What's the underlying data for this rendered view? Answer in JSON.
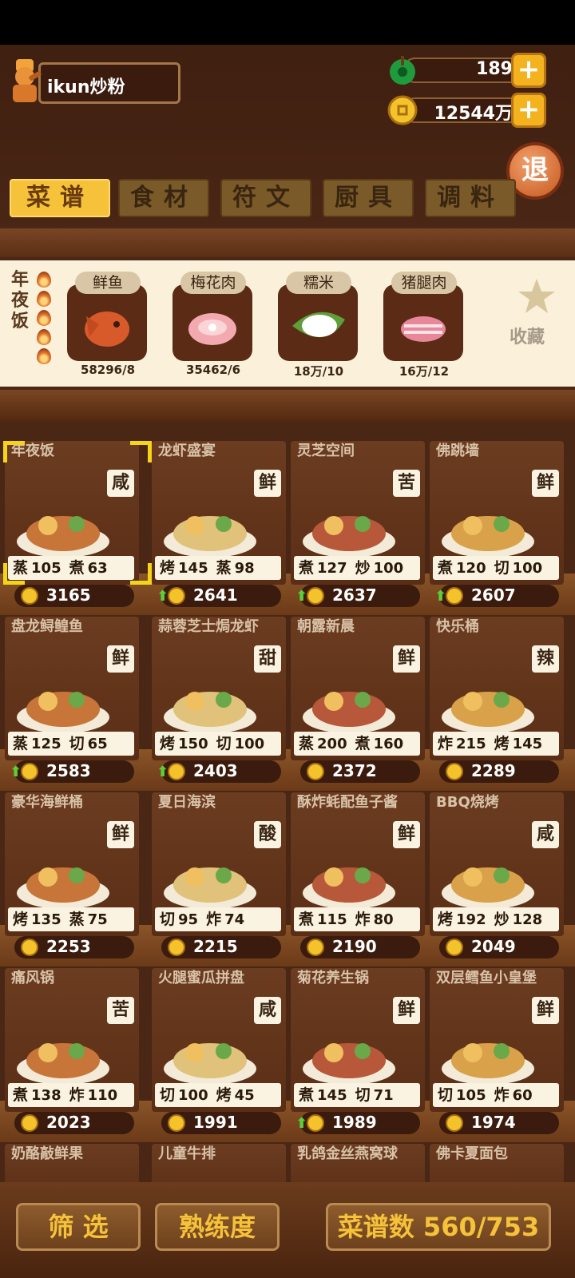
{
  "player": {
    "name": "ikun炒粉"
  },
  "currency": {
    "jade": "189",
    "coins": "12544万"
  },
  "exit_label": "退",
  "tabs": [
    {
      "label": "菜谱",
      "active": true
    },
    {
      "label": "食材",
      "active": false
    },
    {
      "label": "符文",
      "active": false
    },
    {
      "label": "厨具",
      "active": false
    },
    {
      "label": "调料",
      "active": false
    }
  ],
  "event": {
    "title": "年夜饭",
    "ingredients": [
      {
        "name": "鲜鱼",
        "count": "58296/8"
      },
      {
        "name": "梅花肉",
        "count": "35462/6"
      },
      {
        "name": "糯米",
        "count": "18万/10"
      },
      {
        "name": "猪腿肉",
        "count": "16万/12"
      }
    ],
    "favorite_label": "收藏"
  },
  "recipes": [
    {
      "name": "年夜饭",
      "flavor": "咸",
      "stat1": "蒸",
      "v1": "105",
      "stat2": "煮",
      "v2": "63",
      "price": "3165",
      "up": false
    },
    {
      "name": "龙虾盛宴",
      "flavor": "鲜",
      "stat1": "烤",
      "v1": "145",
      "stat2": "蒸",
      "v2": "98",
      "price": "2641",
      "up": true
    },
    {
      "name": "灵芝空间",
      "flavor": "苦",
      "stat1": "煮",
      "v1": "127",
      "stat2": "炒",
      "v2": "100",
      "price": "2637",
      "up": true
    },
    {
      "name": "佛跳墙",
      "flavor": "鲜",
      "stat1": "煮",
      "v1": "120",
      "stat2": "切",
      "v2": "100",
      "price": "2607",
      "up": true
    },
    {
      "name": "盘龙鲟鳇鱼",
      "flavor": "鲜",
      "stat1": "蒸",
      "v1": "125",
      "stat2": "切",
      "v2": "65",
      "price": "2583",
      "up": true
    },
    {
      "name": "蒜蓉芝士焗龙虾",
      "flavor": "甜",
      "stat1": "烤",
      "v1": "150",
      "stat2": "切",
      "v2": "100",
      "price": "2403",
      "up": true
    },
    {
      "name": "朝露新晨",
      "flavor": "鲜",
      "stat1": "蒸",
      "v1": "200",
      "stat2": "煮",
      "v2": "160",
      "price": "2372",
      "up": false
    },
    {
      "name": "快乐桶",
      "flavor": "辣",
      "stat1": "炸",
      "v1": "215",
      "stat2": "烤",
      "v2": "145",
      "price": "2289",
      "up": false
    },
    {
      "name": "豪华海鲜桶",
      "flavor": "鲜",
      "stat1": "烤",
      "v1": "135",
      "stat2": "蒸",
      "v2": "75",
      "price": "2253",
      "up": false
    },
    {
      "name": "夏日海滨",
      "flavor": "酸",
      "stat1": "切",
      "v1": "95",
      "stat2": "炸",
      "v2": "74",
      "price": "2215",
      "up": false
    },
    {
      "name": "酥炸蚝配鱼子酱",
      "flavor": "鲜",
      "stat1": "煮",
      "v1": "115",
      "stat2": "炸",
      "v2": "80",
      "price": "2190",
      "up": false
    },
    {
      "name": "BBQ烧烤",
      "flavor": "咸",
      "stat1": "烤",
      "v1": "192",
      "stat2": "炒",
      "v2": "128",
      "price": "2049",
      "up": false
    },
    {
      "name": "痛风锅",
      "flavor": "苦",
      "stat1": "煮",
      "v1": "138",
      "stat2": "炸",
      "v2": "110",
      "price": "2023",
      "up": false
    },
    {
      "name": "火腿蜜瓜拼盘",
      "flavor": "咸",
      "stat1": "切",
      "v1": "100",
      "stat2": "烤",
      "v2": "45",
      "price": "1991",
      "up": false
    },
    {
      "name": "菊花养生锅",
      "flavor": "鲜",
      "stat1": "煮",
      "v1": "145",
      "stat2": "切",
      "v2": "71",
      "price": "1989",
      "up": true
    },
    {
      "name": "双层鳕鱼小皇堡",
      "flavor": "鲜",
      "stat1": "切",
      "v1": "105",
      "stat2": "炸",
      "v2": "60",
      "price": "1974",
      "up": false
    },
    {
      "name": "奶酪敲鲜果",
      "flavor": "",
      "stat1": "",
      "v1": "",
      "stat2": "",
      "v2": "",
      "price": "",
      "up": false
    },
    {
      "name": "儿童牛排",
      "flavor": "",
      "stat1": "",
      "v1": "",
      "stat2": "",
      "v2": "",
      "price": "",
      "up": false
    },
    {
      "name": "乳鸽金丝燕窝球",
      "flavor": "",
      "stat1": "",
      "v1": "",
      "stat2": "",
      "v2": "",
      "price": "",
      "up": false
    },
    {
      "name": "佛卡夏面包",
      "flavor": "",
      "stat1": "",
      "v1": "",
      "stat2": "",
      "v2": "",
      "price": "",
      "up": false
    }
  ],
  "bottom": {
    "filter_label": "筛 选",
    "mastery_label": "熟练度",
    "recipe_count_label": "菜谱数 560/753"
  }
}
